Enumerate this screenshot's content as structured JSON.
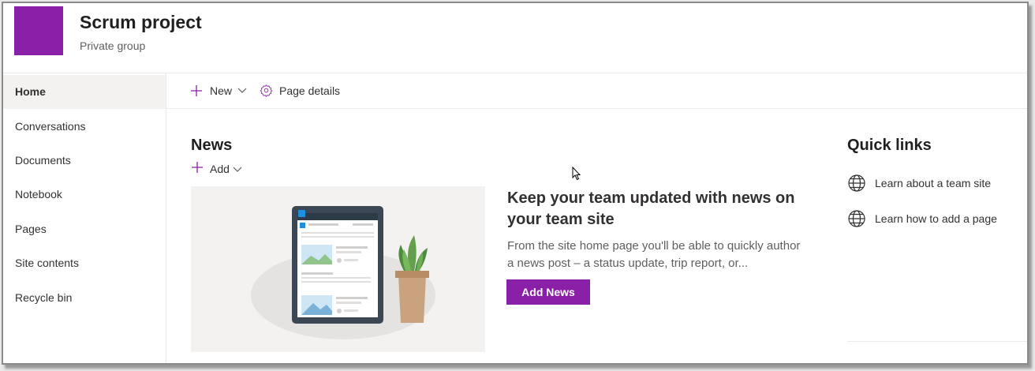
{
  "site": {
    "title": "Scrum project",
    "subtitle": "Private group",
    "logo_color": "#8a1fa8"
  },
  "nav": {
    "items": [
      {
        "label": "Home",
        "selected": true
      },
      {
        "label": "Conversations"
      },
      {
        "label": "Documents"
      },
      {
        "label": "Notebook"
      },
      {
        "label": "Pages"
      },
      {
        "label": "Site contents"
      },
      {
        "label": "Recycle bin"
      }
    ]
  },
  "command_bar": {
    "new_label": "New",
    "new_icon": "plus-icon",
    "page_details_label": "Page details",
    "page_details_icon": "gear-icon"
  },
  "news": {
    "title": "News",
    "add_label": "Add",
    "promo_heading": "Keep your team updated with news on your team site",
    "promo_body": "From the site home page you'll be able to quickly author a news post – a status update, trip report, or...",
    "add_news_button": "Add News",
    "accent_color": "#8a1fa8"
  },
  "quick_links": {
    "title": "Quick links",
    "items": [
      {
        "label": "Learn about a team site",
        "icon": "globe-icon"
      },
      {
        "label": "Learn how to add a page",
        "icon": "globe-icon"
      }
    ]
  }
}
